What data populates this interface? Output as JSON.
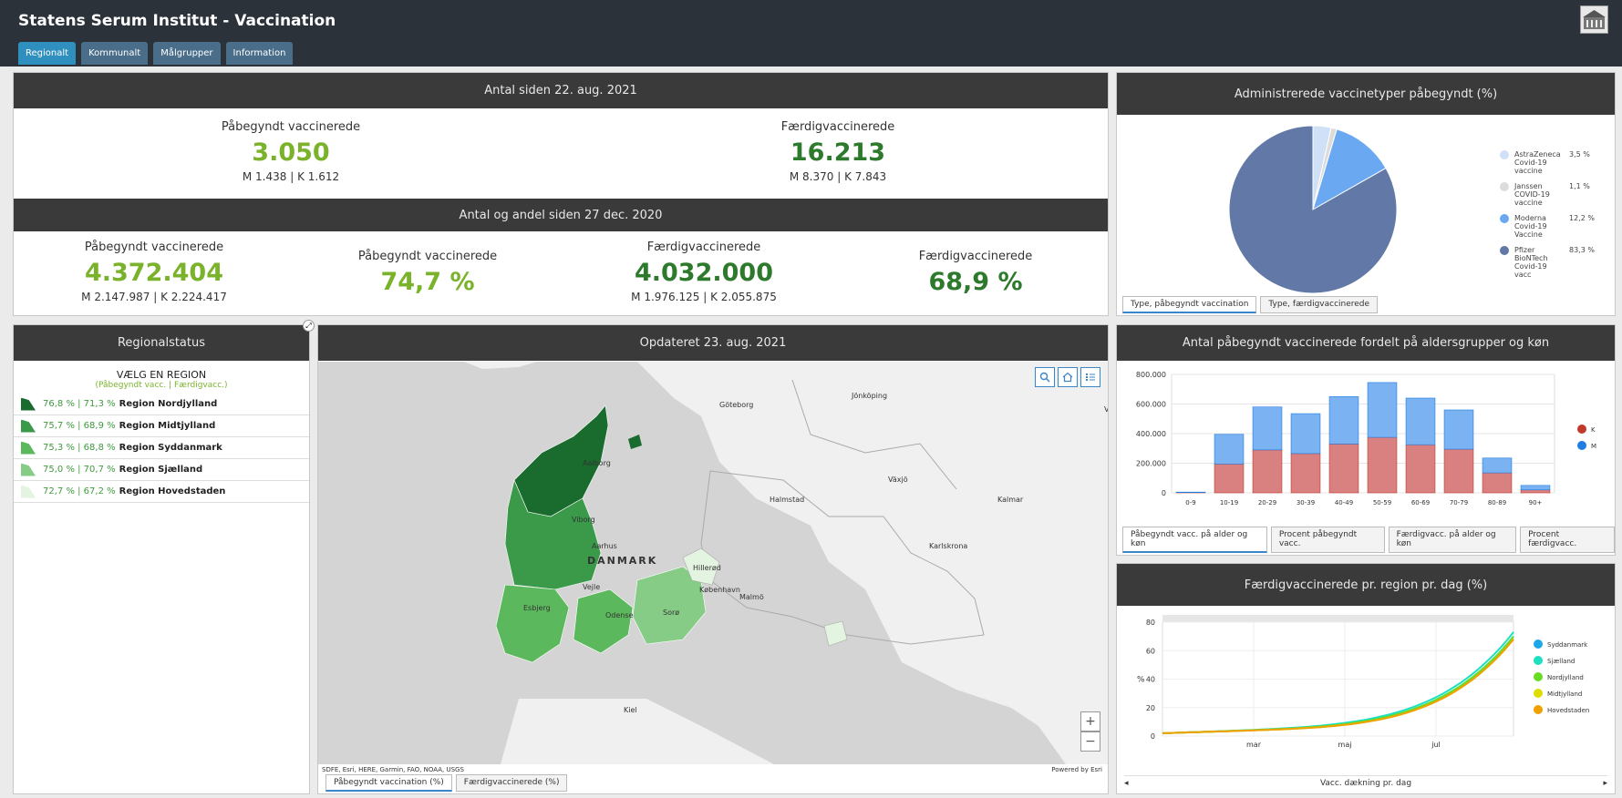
{
  "app": {
    "title": "Statens Serum Institut - Vaccination",
    "tabs": [
      "Regionalt",
      "Kommunalt",
      "Målgrupper",
      "Information"
    ]
  },
  "summary": {
    "top_header": "Antal siden 22. aug. 2021",
    "top": [
      {
        "label": "Påbegyndt vaccinerede",
        "value": "3.050",
        "sub": "M 1.438 | K 1.612"
      },
      {
        "label": "Færdigvaccinerede",
        "value": "16.213",
        "sub": "M 8.370 | K 7.843"
      }
    ],
    "bottom_header": "Antal og andel siden 27 dec. 2020",
    "bottom": [
      {
        "label": "Påbegyndt vaccinerede",
        "value": "4.372.404",
        "sub": "M 2.147.987 | K 2.224.417"
      },
      {
        "label": "Påbegyndt vaccinerede",
        "value": "74,7 %"
      },
      {
        "label": "Færdigvaccinerede",
        "value": "4.032.000",
        "sub": "M 1.976.125 | K 2.055.875"
      },
      {
        "label": "Færdigvaccinerede",
        "value": "68,9 %"
      }
    ]
  },
  "pie": {
    "header": "Administrerede vaccinetyper påbegyndt (%)",
    "tabs": [
      "Type, påbegyndt vaccination",
      "Type, færdigvaccinerede"
    ]
  },
  "region": {
    "header": "Regionalstatus",
    "title": "VÆLG EN REGION",
    "subtitle": "(Påbegyndt vacc. | Færdigvacc.)",
    "items": [
      {
        "pct": "76,8 % | 71,3 %",
        "name": "Region Nordjylland",
        "color": "#1a6b2e"
      },
      {
        "pct": "75,7 % | 68,9 %",
        "name": "Region Midtjylland",
        "color": "#3a9a4a"
      },
      {
        "pct": "75,3 % | 68,8 %",
        "name": "Region Syddanmark",
        "color": "#5cb85c"
      },
      {
        "pct": "75,0 % | 70,7 %",
        "name": "Region Sjælland",
        "color": "#86cc86"
      },
      {
        "pct": "72,7 % | 67,2 %",
        "name": "Region Hovedstaden",
        "color": "#e3f4e0"
      }
    ]
  },
  "map": {
    "header": "Opdateret 23. aug. 2021",
    "attribution": "SDFE, Esri, HERE, Garmin, FAO, NOAA, USGS",
    "powered": "Powered by Esri",
    "tabs": [
      "Påbegyndt vaccination (%)",
      "Færdigvaccinerede (%)"
    ],
    "labels": [
      "Göteborg",
      "Jönköping",
      "Växjö",
      "Halmstad",
      "Kalmar",
      "Karlskrona",
      "Visby",
      "Aalborg",
      "Viborg",
      "Aarhus",
      "DANMARK",
      "Vejle",
      "Esbjerg",
      "Odense",
      "Sorø",
      "Hillerød",
      "København",
      "Malmö",
      "Kiel"
    ],
    "zoom_in": "+",
    "zoom_out": "−"
  },
  "age": {
    "header": "Antal påbegyndt vaccinerede fordelt på aldersgrupper og køn",
    "tabs": [
      "Påbegyndt vacc. på alder og køn",
      "Procent påbegyndt vacc.",
      "Færdigvacc. på alder og køn",
      "Procent færdigvacc."
    ]
  },
  "line": {
    "header": "Færdigvaccinerede pr. region pr. dag (%)",
    "footer": "Vacc. dækning pr. dag",
    "nav_left": "◂",
    "nav_right": "▸"
  },
  "chart_data": [
    {
      "type": "pie",
      "series": [
        {
          "name": "AstraZeneca Covid-19 vaccine",
          "value": 3.5,
          "label": "3,5 %",
          "color": "#cfe0f7"
        },
        {
          "name": "Janssen COVID-19 vaccine",
          "value": 1.1,
          "label": "1,1 %",
          "color": "#dcdcdc"
        },
        {
          "name": "Moderna Covid-19 Vaccine",
          "value": 12.2,
          "label": "12,2 %",
          "color": "#6aa8f2"
        },
        {
          "name": "Pfizer BioNTech Covid-19 vacc",
          "value": 83.3,
          "label": "83,3 %",
          "color": "#6279a8"
        }
      ]
    },
    {
      "type": "bar",
      "categories": [
        "0-9",
        "10-19",
        "20-29",
        "30-39",
        "40-49",
        "50-59",
        "60-69",
        "70-79",
        "80-89",
        "90+"
      ],
      "series": [
        {
          "name": "K",
          "color": "#c0392b",
          "values": [
            2000,
            195000,
            290000,
            265000,
            330000,
            375000,
            325000,
            295000,
            135000,
            20000
          ]
        },
        {
          "name": "M",
          "color": "#1f7ce0",
          "values": [
            3000,
            200000,
            290000,
            270000,
            320000,
            370000,
            315000,
            265000,
            100000,
            30000
          ]
        }
      ],
      "yticks": [
        "0",
        "200.000",
        "400.000",
        "600.000",
        "800.000"
      ],
      "ylim": [
        0,
        800000
      ]
    },
    {
      "type": "line",
      "ylabel": "%",
      "ylim": [
        0,
        80
      ],
      "yticks": [
        "0",
        "20",
        "40",
        "60",
        "80"
      ],
      "xticks": [
        "mar",
        "maj",
        "jul"
      ],
      "series": [
        {
          "name": "Syddanmark",
          "color": "#1ca7e8"
        },
        {
          "name": "Sjælland",
          "color": "#1de0c0"
        },
        {
          "name": "Nordjylland",
          "color": "#66dd22"
        },
        {
          "name": "Midtjylland",
          "color": "#dddd00"
        },
        {
          "name": "Hovedstaden",
          "color": "#f0a000"
        }
      ]
    }
  ]
}
